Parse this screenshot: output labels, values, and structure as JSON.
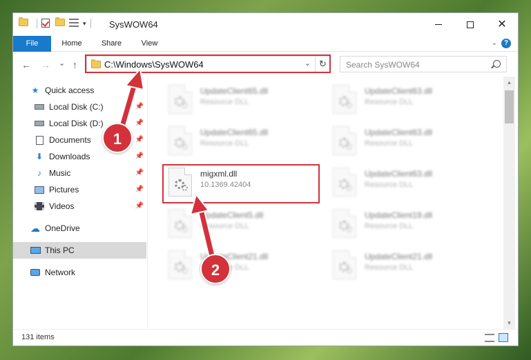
{
  "window": {
    "title": "SysWOW64",
    "controls": {
      "minimize": "minimize",
      "maximize": "maximize",
      "close": "✕"
    }
  },
  "ribbon": {
    "tabs": [
      {
        "label": "File"
      },
      {
        "label": "Home"
      },
      {
        "label": "Share"
      },
      {
        "label": "View"
      }
    ],
    "help": "?"
  },
  "nav": {
    "back": "←",
    "forward": "→",
    "recent": "⌄",
    "up": "↑",
    "address": "C:\\Windows\\SysWOW64",
    "refresh": "↻",
    "search_placeholder": "Search SysWOW64"
  },
  "sidebar": {
    "items": [
      {
        "label": "Quick access",
        "icon": "star-icon"
      },
      {
        "label": "Local Disk (C:)",
        "icon": "drive-icon",
        "pinned": true
      },
      {
        "label": "Local Disk (D:)",
        "icon": "drive-icon",
        "pinned": true
      },
      {
        "label": "Documents",
        "icon": "document-icon",
        "pinned": true
      },
      {
        "label": "Downloads",
        "icon": "download-icon",
        "pinned": true
      },
      {
        "label": "Music",
        "icon": "music-icon",
        "pinned": true
      },
      {
        "label": "Pictures",
        "icon": "picture-icon",
        "pinned": true
      },
      {
        "label": "Videos",
        "icon": "video-icon",
        "pinned": true
      },
      {
        "label": "OneDrive",
        "icon": "cloud-icon"
      },
      {
        "label": "This PC",
        "icon": "computer-icon",
        "selected": true
      },
      {
        "label": "Network",
        "icon": "network-icon"
      }
    ]
  },
  "files": {
    "left": [
      {
        "name": "UpdateClient65.dll",
        "desc": "Resource DLL"
      },
      {
        "name": "UpdateClient65.dll",
        "desc": "Resource DLL"
      },
      {
        "name": "migxml.dll",
        "desc": "10.1369.42404"
      },
      {
        "name": "UpdateClient5.dll",
        "desc": "Resource DLL"
      },
      {
        "name": "UpdateClient21.dll",
        "desc": "Resource DLL"
      }
    ],
    "right": [
      {
        "name": "UpdateClient63.dll",
        "desc": "Resource DLL"
      },
      {
        "name": "UpdateClient63.dll",
        "desc": "Resource DLL"
      },
      {
        "name": "UpdateClient63.dll",
        "desc": "Resource DLL"
      },
      {
        "name": "UpdateClient19.dll",
        "desc": "Resource DLL"
      },
      {
        "name": "UpdateClient21.dll",
        "desc": "Resource DLL"
      }
    ]
  },
  "status": {
    "count": "131 items"
  },
  "annotations": {
    "step1": "1",
    "step2": "2"
  },
  "colors": {
    "accent": "#1979ca",
    "highlight": "#d3313b"
  }
}
